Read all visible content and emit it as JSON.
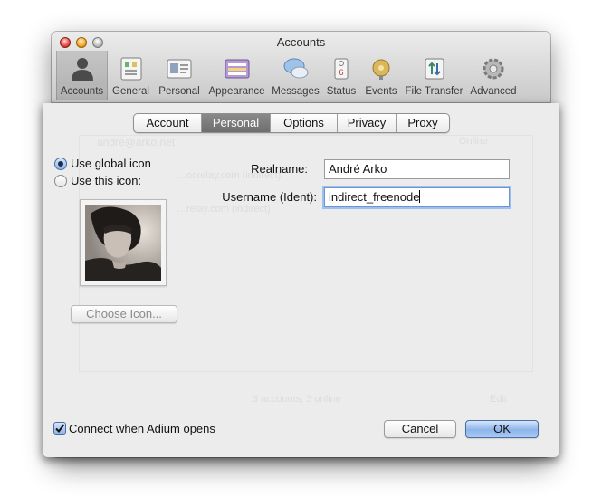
{
  "window": {
    "title": "Accounts"
  },
  "toolbar": {
    "items": [
      {
        "label": "Accounts",
        "icon": "accounts-icon",
        "selected": true
      },
      {
        "label": "General",
        "icon": "general-icon"
      },
      {
        "label": "Personal",
        "icon": "personal-icon"
      },
      {
        "label": "Appearance",
        "icon": "appearance-icon"
      },
      {
        "label": "Messages",
        "icon": "messages-icon"
      },
      {
        "label": "Status",
        "icon": "status-icon"
      },
      {
        "label": "Events",
        "icon": "events-icon"
      },
      {
        "label": "File Transfer",
        "icon": "file-transfer-icon"
      },
      {
        "label": "Advanced",
        "icon": "advanced-icon"
      }
    ]
  },
  "background_list": {
    "row1": "andre@arko.net",
    "row1_status": "Online",
    "row2": "…ocrelay.com (indirect)",
    "row3": "…relay.com (indirect)",
    "footer_count": "3 accounts, 3 online",
    "edit_label": "Edit"
  },
  "tabs": {
    "items": [
      "Account",
      "Personal",
      "Options",
      "Privacy",
      "Proxy"
    ],
    "active": "Personal"
  },
  "icon_options": {
    "global_label": "Use global icon",
    "custom_label": "Use this icon:",
    "selected": "global",
    "choose_button": "Choose Icon..."
  },
  "fields": {
    "realname_label": "Realname:",
    "realname_value": "André Arko",
    "username_label": "Username (Ident):",
    "username_value": "indirect_freenode"
  },
  "footer": {
    "connect_label": "Connect when Adium opens",
    "connect_checked": true,
    "cancel_label": "Cancel",
    "ok_label": "OK"
  },
  "colors": {
    "default_button": "#8db5ea",
    "active_tab": "#7a7a7a",
    "focus_ring": "#9cc0f1"
  }
}
